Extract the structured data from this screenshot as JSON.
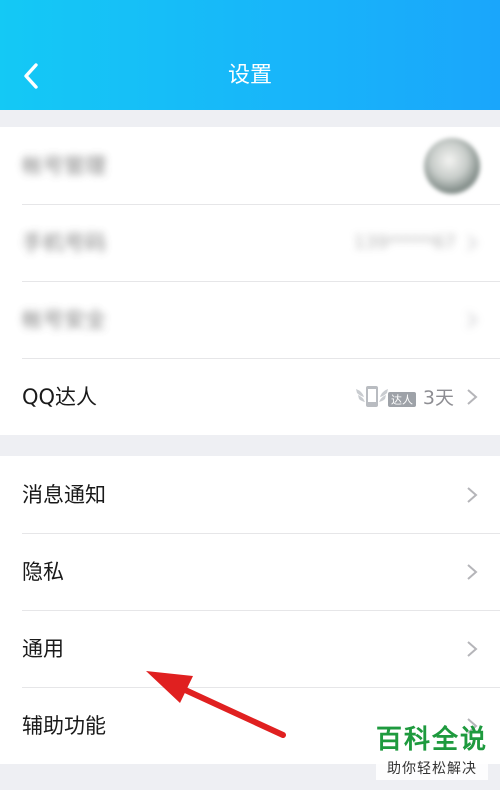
{
  "header": {
    "title": "设置",
    "back_icon": "chevron-left-icon",
    "gradient": [
      "#14c9f5",
      "#1aa6fb"
    ]
  },
  "group1": {
    "rows": [
      {
        "label": "帐号管理",
        "blurred": true
      },
      {
        "label": "手机号码",
        "value": "139*****67",
        "blurred": true
      },
      {
        "label": "帐号安全",
        "blurred": true
      },
      {
        "label": "QQ达人",
        "badge_text": "达人",
        "value": "3天"
      }
    ]
  },
  "group2": {
    "rows": [
      {
        "label": "消息通知"
      },
      {
        "label": "隐私"
      },
      {
        "label": "通用"
      },
      {
        "label": "辅助功能"
      }
    ]
  },
  "annotation": {
    "color": "#e02020",
    "icon": "red-arrow"
  },
  "watermark": {
    "main": "百科全说",
    "sub": "助你轻松解决"
  }
}
